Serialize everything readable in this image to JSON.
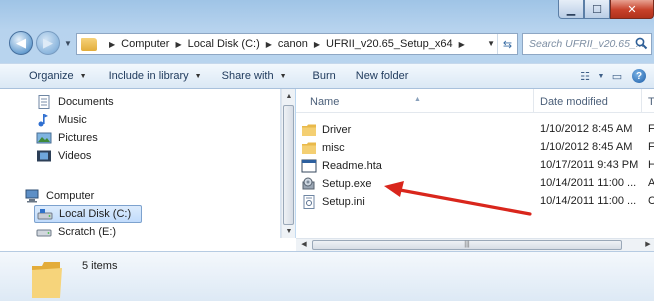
{
  "window": {
    "caption_buttons": [
      "minimize",
      "maximize",
      "close"
    ]
  },
  "address_bar": {
    "breadcrumbs": [
      "Computer",
      "Local Disk (C:)",
      "canon",
      "UFRII_v20.65_Setup_x64"
    ],
    "search_placeholder": "Search UFRII_v20.65_..."
  },
  "toolbar": {
    "organize": "Organize",
    "include_in_library": "Include in library",
    "share_with": "Share with",
    "burn": "Burn",
    "new_folder": "New folder"
  },
  "nav_pane": {
    "items": [
      {
        "label": "Documents",
        "icon": "documents-icon"
      },
      {
        "label": "Music",
        "icon": "music-icon"
      },
      {
        "label": "Pictures",
        "icon": "pictures-icon"
      },
      {
        "label": "Videos",
        "icon": "videos-icon"
      },
      {
        "label": "Computer",
        "icon": "computer-icon"
      },
      {
        "label": "Local Disk (C:)",
        "icon": "drive-icon",
        "selected": true
      },
      {
        "label": "Scratch (E:)",
        "icon": "drive-icon"
      }
    ]
  },
  "file_list": {
    "columns": {
      "name": "Name",
      "date": "Date modified",
      "type": "T"
    },
    "rows": [
      {
        "name": "Driver",
        "date": "1/10/2012 8:45 AM",
        "type": "F",
        "icon": "folder-icon"
      },
      {
        "name": "misc",
        "date": "1/10/2012 8:45 AM",
        "type": "F",
        "icon": "folder-icon"
      },
      {
        "name": "Readme.hta",
        "date": "10/17/2011 9:43 PM",
        "type": "H",
        "icon": "hta-file-icon"
      },
      {
        "name": "Setup.exe",
        "date": "10/14/2011 11:00 ...",
        "type": "A",
        "icon": "setup-exe-icon"
      },
      {
        "name": "Setup.ini",
        "date": "10/14/2011 11:00 ...",
        "type": "C",
        "icon": "ini-file-icon"
      }
    ]
  },
  "details": {
    "items_count": "5 items"
  },
  "colors": {
    "annotation_arrow": "#d9261c"
  }
}
